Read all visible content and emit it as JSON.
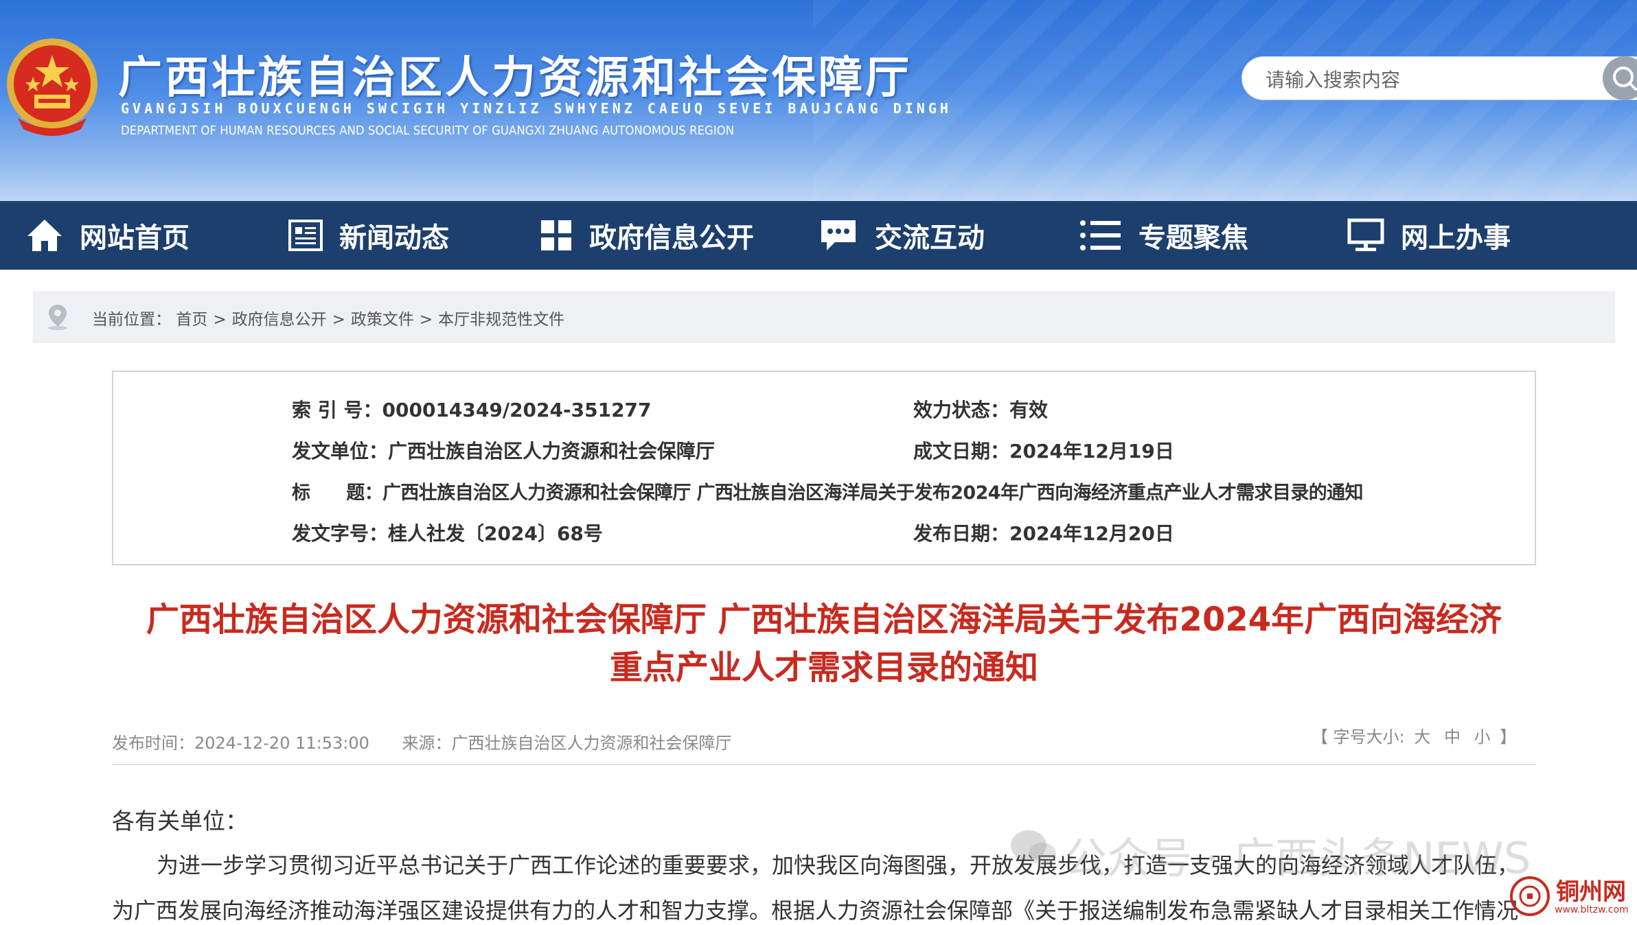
{
  "header": {
    "title_zh": "广西壮族自治区人力资源和社会保障厅",
    "title_zhuang": "GVANGJSIH BOUXCUENGH SWCIGIH YINZLIZ SWHYENZ CAEUQ SEVEI BAUJCANG DINGH",
    "title_en": "DEPARTMENT OF HUMAN RESOURCES AND SOCIAL SECURITY OF GUANGXI ZHUANG AUTONOMOUS REGION",
    "search_placeholder": "请输入搜索内容"
  },
  "nav": {
    "items": [
      {
        "label": "网站首页",
        "icon": "home-icon"
      },
      {
        "label": "新闻动态",
        "icon": "news-icon"
      },
      {
        "label": "政府信息公开",
        "icon": "grid-icon"
      },
      {
        "label": "交流互动",
        "icon": "chat-icon"
      },
      {
        "label": "专题聚焦",
        "icon": "list-icon"
      },
      {
        "label": "网上办事",
        "icon": "monitor-icon"
      }
    ]
  },
  "breadcrumb": {
    "prefix": "当前位置：",
    "items": [
      "首页",
      "政府信息公开",
      "政策文件",
      "本厅非规范性文件"
    ],
    "separator": ">"
  },
  "meta": {
    "index_label": "索 引 号：",
    "index_value": "000014349/2024-351277",
    "status_label": "效力状态：",
    "status_value": "有效",
    "issuer_label": "发文单位：",
    "issuer_value": "广西壮族自治区人力资源和社会保障厅",
    "date_written_label": "成文日期：",
    "date_written_value": "2024年12月19日",
    "title_label": "标　　题：",
    "title_value": "广西壮族自治区人力资源和社会保障厅 广西壮族自治区海洋局关于发布2024年广西向海经济重点产业人才需求目录的通知",
    "docno_label": "发文字号：",
    "docno_value": "桂人社发〔2024〕68号",
    "pubdate_label": "发布日期：",
    "pubdate_value": "2024年12月20日"
  },
  "article": {
    "title_line1": "广西壮族自治区人力资源和社会保障厅 广西壮族自治区海洋局关于发布2024年广西向海经济",
    "title_line2": "重点产业人才需求目录的通知",
    "pub_time": "发布时间：2024-12-20 11:53:00",
    "source": "来源：广西壮族自治区人力资源和社会保障厅",
    "fontsize_open": "【 字号大小:",
    "fontsize_large": "大",
    "fontsize_medium": "中",
    "fontsize_small": "小",
    "fontsize_close": "】",
    "salutation": "各有关单位：",
    "para1": "为进一步学习贯彻习近平总书记关于广西工作论述的重要要求，加快我区向海图强，开放发展步伐，打造一支强大的向海经济领域人才队伍，",
    "para2": "为广西发展向海经济推动海洋强区建设提供有力的人才和智力支撑。根据人力资源社会保障部《关于报送编制发布急需紧缺人才目录相关工作情况"
  },
  "watermark": {
    "text": "公众号 · 广西头条NEWS"
  },
  "corner_logo": {
    "name": "铜州网",
    "url": "www.bltzw.com"
  },
  "colors": {
    "nav_bg": "#1d3f6e",
    "title_red": "#c82a1f",
    "header_blue": "#2f73d9"
  }
}
